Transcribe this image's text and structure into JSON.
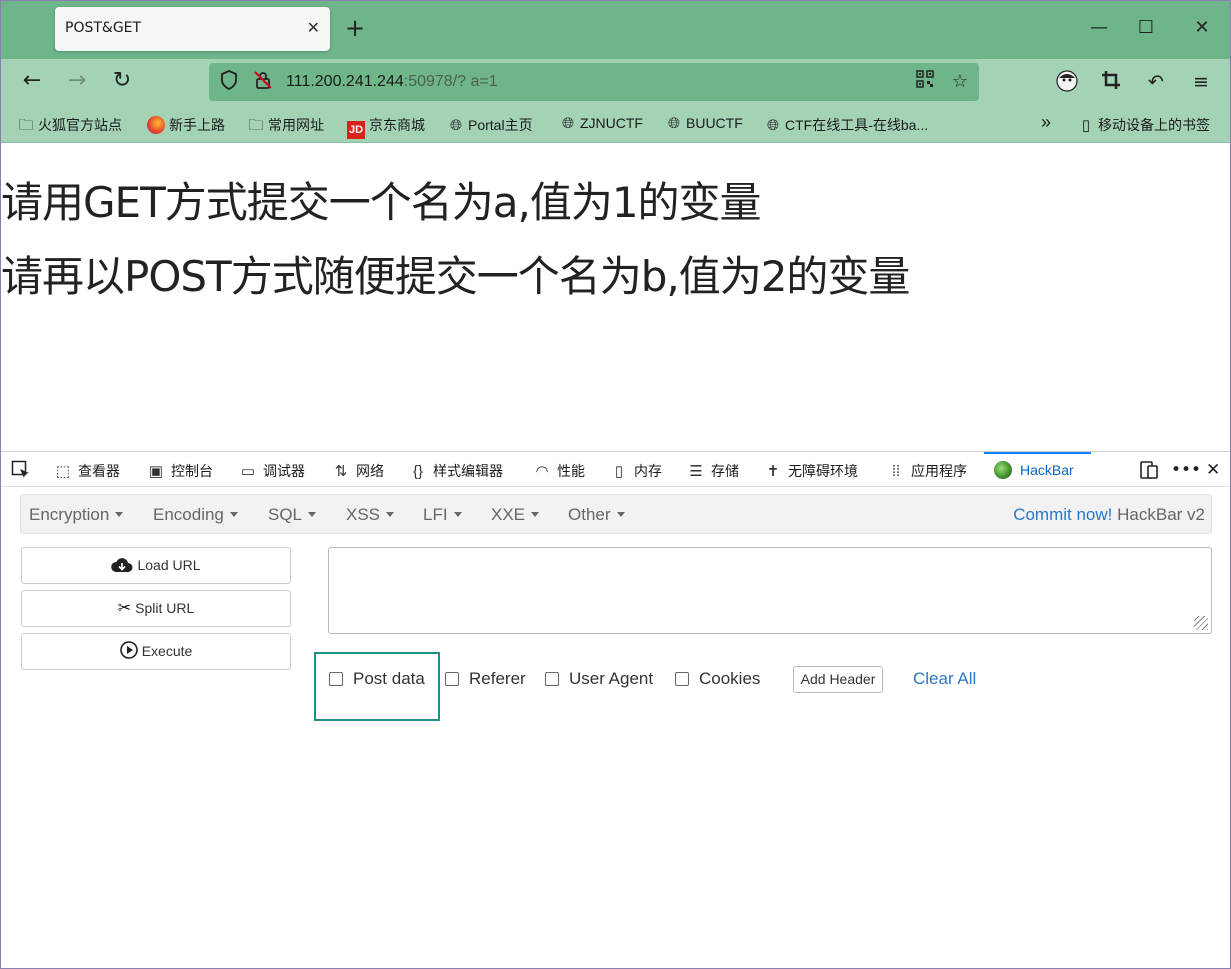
{
  "browser": {
    "tab_title": "POST&GET",
    "tab_close": "✕",
    "new_tab": "+",
    "window": {
      "minimize": "—",
      "maximize": "☐",
      "close": "✕"
    }
  },
  "nav": {
    "back": "←",
    "forward": "→",
    "reload": "↻",
    "url_host": "111.200.241.244",
    "url_rest": ":50978/? a=1"
  },
  "bookmarks": [
    {
      "label": "火狐官方站点",
      "icon": "folder-icon"
    },
    {
      "label": "新手上路",
      "icon": "firefox-icon"
    },
    {
      "label": "常用网址",
      "icon": "folder-icon"
    },
    {
      "label": "京东商城",
      "icon": "jd-icon"
    },
    {
      "label": "Portal主页",
      "icon": "globe-icon"
    },
    {
      "label": "ZJNUCTF",
      "icon": "globe-icon"
    },
    {
      "label": "BUUCTF",
      "icon": "globe-icon"
    },
    {
      "label": "CTF在线工具-在线ba...",
      "icon": "globe-icon"
    }
  ],
  "bookmarks_more": "»",
  "mobile_bookmarks": "移动设备上的书签",
  "page": {
    "line1": "请用GET方式提交一个名为a,值为1的变量",
    "line2": "请再以POST方式随便提交一个名为b,值为2的变量"
  },
  "devtools": {
    "tabs": [
      "查看器",
      "控制台",
      "调试器",
      "网络",
      "样式编辑器",
      "性能",
      "内存",
      "存储",
      "无障碍环境",
      "应用程序",
      "HackBar"
    ],
    "active_tab": "HackBar"
  },
  "hackbar": {
    "menu": [
      "Encryption",
      "Encoding",
      "SQL",
      "XSS",
      "LFI",
      "XXE",
      "Other"
    ],
    "commit_link": "Commit now!",
    "version": "HackBar v2",
    "load_url": "Load URL",
    "split_url": "Split URL",
    "execute": "Execute",
    "url_value": "",
    "options": [
      "Post data",
      "Referer",
      "User Agent",
      "Cookies"
    ],
    "add_header": "Add Header",
    "clear_all": "Clear All"
  },
  "colors": {
    "titlebar": "#6fb58a",
    "toolbar": "#a4d2b5",
    "highlight": "#1a9088",
    "link": "#2a79c5"
  }
}
